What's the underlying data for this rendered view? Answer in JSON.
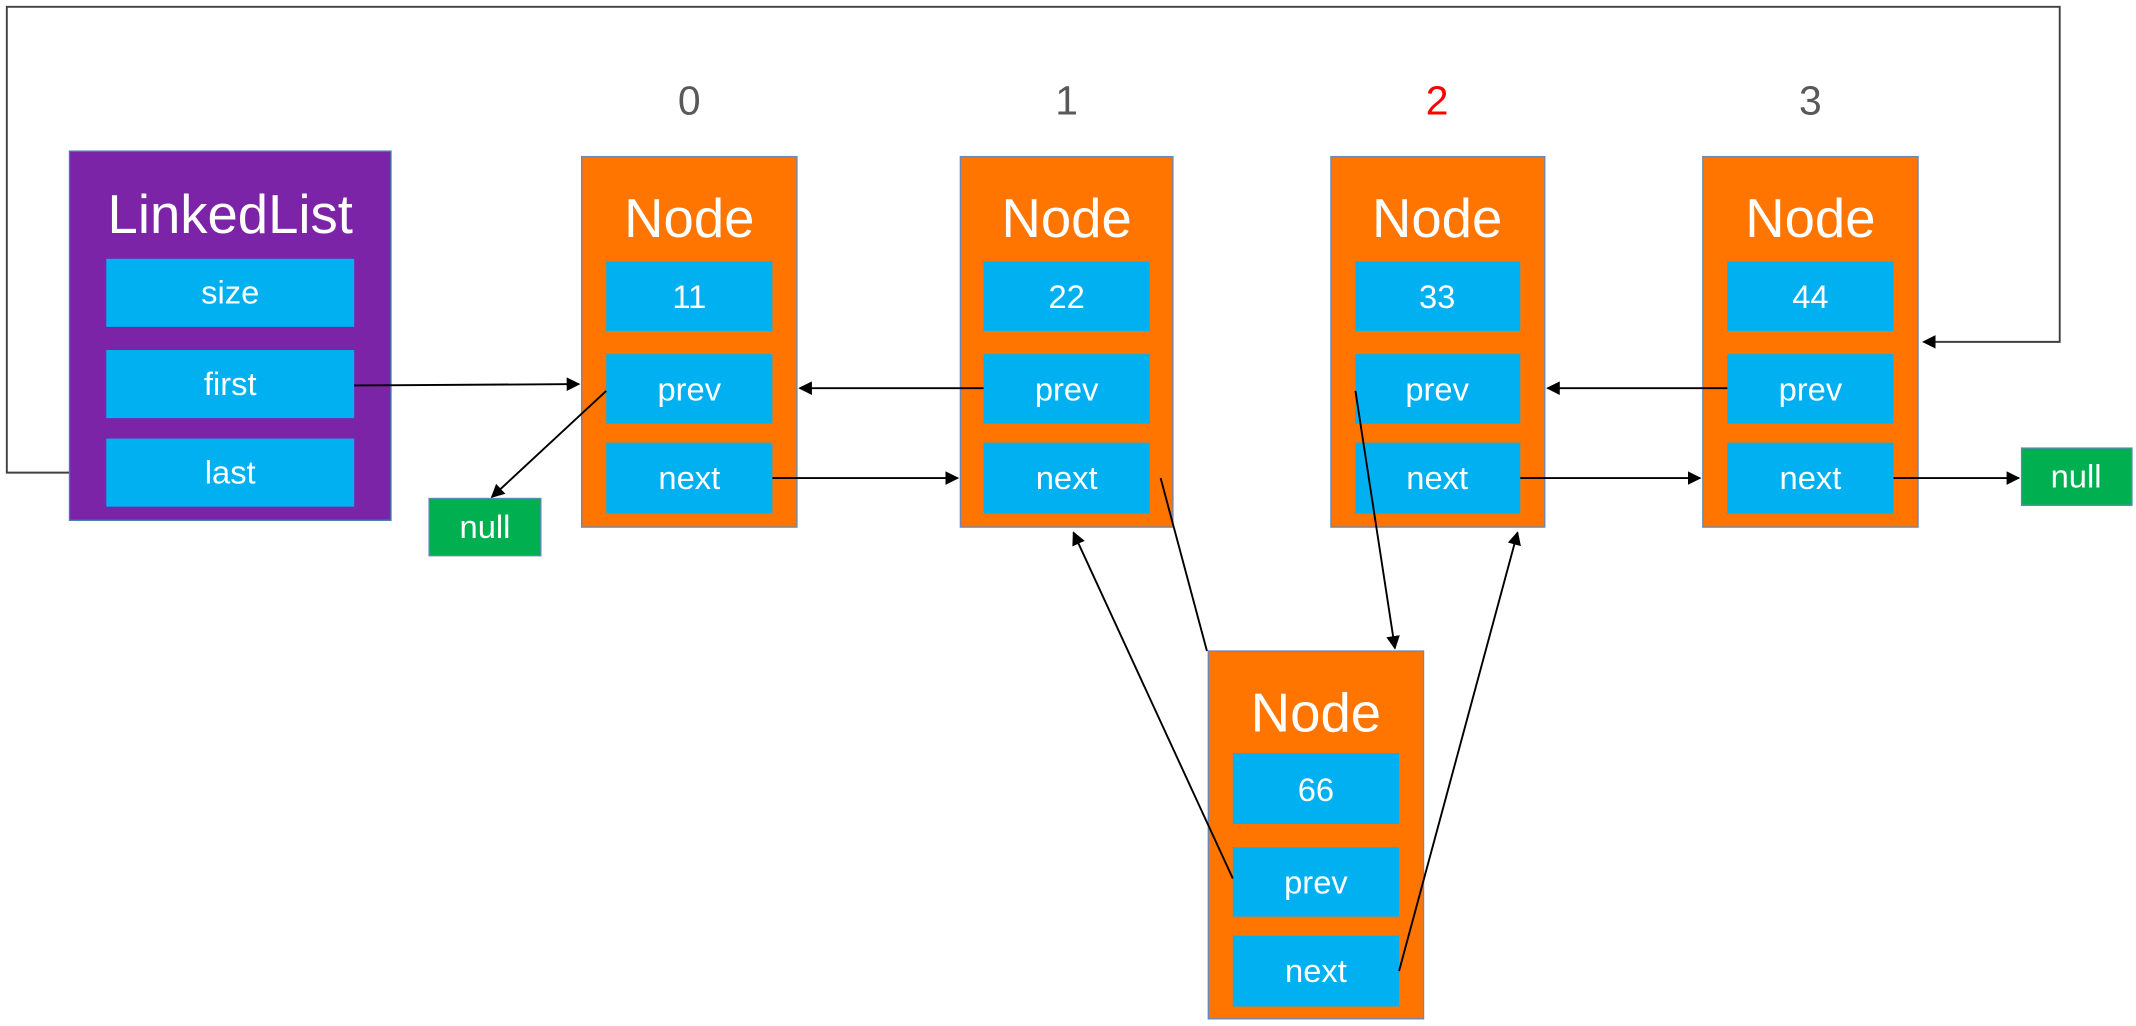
{
  "colors": {
    "linkedlist": "#7B24A8",
    "node": "#FF7500",
    "field": "#00B0F0",
    "null": "#00B050",
    "index_default": "#595959",
    "index_highlight": "#FF0000"
  },
  "linked_list": {
    "title": "LinkedList",
    "fields": [
      "size",
      "first",
      "last"
    ]
  },
  "indices": [
    "0",
    "1",
    "2",
    "3"
  ],
  "highlighted_index": "2",
  "nodes": [
    {
      "title": "Node",
      "value": "11",
      "prev": "prev",
      "next": "next"
    },
    {
      "title": "Node",
      "value": "22",
      "prev": "prev",
      "next": "next"
    },
    {
      "title": "Node",
      "value": "33",
      "prev": "prev",
      "next": "next"
    },
    {
      "title": "Node",
      "value": "44",
      "prev": "prev",
      "next": "next"
    }
  ],
  "new_node": {
    "title": "Node",
    "value": "66",
    "prev": "prev",
    "next": "next"
  },
  "null_left": "null",
  "null_right": "null"
}
